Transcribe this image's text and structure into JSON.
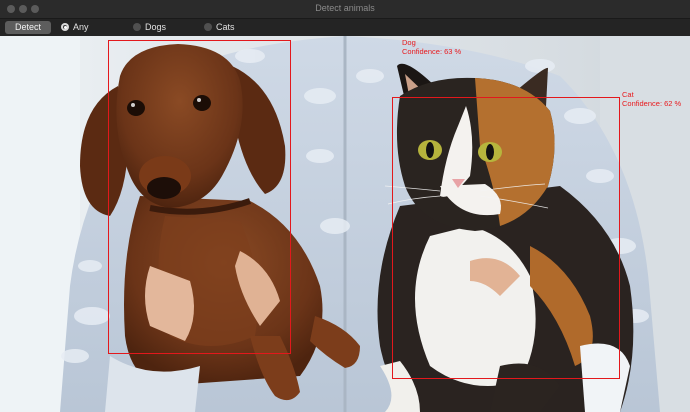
{
  "window": {
    "title": "Detect animals"
  },
  "toolbar": {
    "detect_label": "Detect",
    "filter_options": [
      {
        "label": "Any",
        "selected": true
      },
      {
        "label": "Dogs",
        "selected": false
      },
      {
        "label": "Cats",
        "selected": false
      }
    ]
  },
  "detections": [
    {
      "label": "Dog",
      "confidence_text": "Confidence: 63 %",
      "confidence": 0.63
    },
    {
      "label": "Cat",
      "confidence_text": "Confidence: 62 %",
      "confidence": 0.62
    }
  ],
  "colors": {
    "box": "#e3181c",
    "button": "#5d5d5d",
    "titlebar": "#2b2b2b"
  }
}
